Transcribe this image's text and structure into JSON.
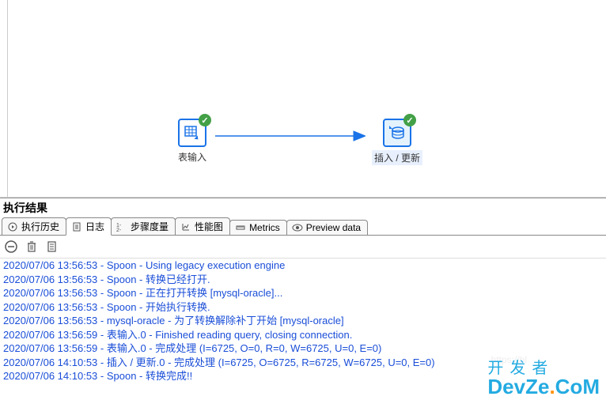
{
  "canvas": {
    "nodes": [
      {
        "id": "table-input",
        "label": "表输入",
        "selected": false,
        "check": true
      },
      {
        "id": "insert-update",
        "label": "插入 / 更新",
        "selected": true,
        "check": true
      }
    ]
  },
  "result": {
    "title": "执行结果",
    "tabs": [
      {
        "id": "history",
        "label": "执行历史",
        "icon": "play"
      },
      {
        "id": "log",
        "label": "日志",
        "icon": "doc",
        "active": true
      },
      {
        "id": "step-metrics",
        "label": "步骤度量",
        "icon": "levels"
      },
      {
        "id": "perf",
        "label": "性能图",
        "icon": "chart"
      },
      {
        "id": "metrics",
        "label": "Metrics",
        "icon": "ruler"
      },
      {
        "id": "preview",
        "label": "Preview data",
        "icon": "eye"
      }
    ],
    "toolbar": {
      "stop": "stop",
      "delete": "delete",
      "clear": "clear"
    },
    "log_lines": [
      "2020/07/06 13:56:53 - Spoon - Using legacy execution engine",
      "2020/07/06 13:56:53 - Spoon - 转换已经打开.",
      "2020/07/06 13:56:53 - Spoon - 正在打开转换 [mysql-oracle]...",
      "2020/07/06 13:56:53 - Spoon - 开始执行转换.",
      "2020/07/06 13:56:53 - mysql-oracle - 为了转换解除补丁开始  [mysql-oracle]",
      "2020/07/06 13:56:59 - 表输入.0 - Finished reading query, closing connection.",
      "2020/07/06 13:56:59 - 表输入.0 - 完成处理 (I=6725, O=0, R=0, W=6725, U=0, E=0)",
      "2020/07/06 14:10:53 - 插入 / 更新.0 - 完成处理 (I=6725, O=6725, R=6725, W=6725, U=0, E=0)",
      "2020/07/06 14:10:53 - Spoon - 转换完成!!"
    ]
  },
  "watermark": {
    "line1": "开发者",
    "line2a": "DevZe",
    "line2b": "CoM"
  },
  "faded": "https://bl"
}
